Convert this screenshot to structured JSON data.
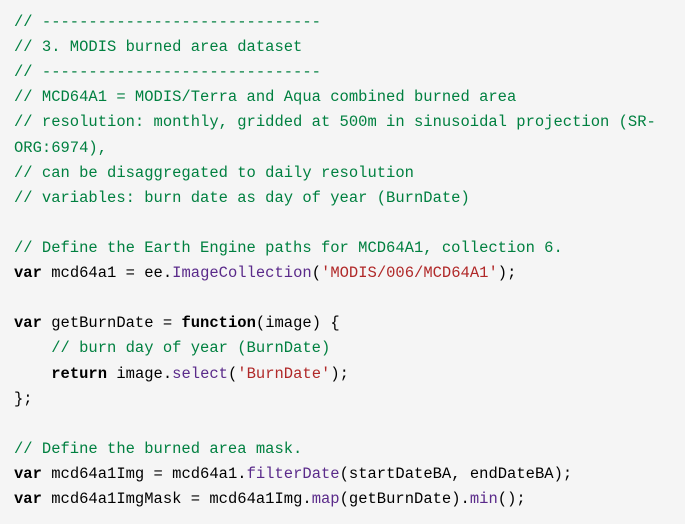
{
  "chart_data": {
    "type": "table",
    "title": "JavaScript code snippet – MODIS burned-area dataset definition",
    "language": "javascript",
    "lines": [
      {
        "text": "// ------------------------------",
        "kind": "comment"
      },
      {
        "text": "// 3. MODIS burned area dataset",
        "kind": "comment"
      },
      {
        "text": "// ------------------------------",
        "kind": "comment"
      },
      {
        "text": "// MCD64A1 = MODIS/Terra and Aqua combined burned area",
        "kind": "comment"
      },
      {
        "text": "// resolution: monthly, gridded at 500m in sinusoidal projection (SR-ORG:6974),",
        "kind": "comment"
      },
      {
        "text": "// can be disaggregated to daily resolution",
        "kind": "comment"
      },
      {
        "text": "// variables: burn date as day of year (BurnDate)",
        "kind": "comment"
      },
      {
        "text": "",
        "kind": "blank"
      },
      {
        "text": "// Define the Earth Engine paths for MCD64A1, collection 6.",
        "kind": "comment"
      },
      {
        "text": "var mcd64a1 = ee.ImageCollection('MODIS/006/MCD64A1');",
        "kind": "code"
      },
      {
        "text": "",
        "kind": "blank"
      },
      {
        "text": "var getBurnDate = function(image) {",
        "kind": "code"
      },
      {
        "text": "    // burn day of year (BurnDate)",
        "kind": "comment-indented"
      },
      {
        "text": "    return image.select('BurnDate');",
        "kind": "code-indented"
      },
      {
        "text": "};",
        "kind": "code"
      },
      {
        "text": "",
        "kind": "blank"
      },
      {
        "text": "// Define the burned area mask.",
        "kind": "comment"
      },
      {
        "text": "var mcd64a1Img = mcd64a1.filterDate(startDateBA, endDateBA);",
        "kind": "code"
      },
      {
        "text": "var mcd64a1ImgMask = mcd64a1Img.map(getBurnDate).min();",
        "kind": "code"
      }
    ]
  },
  "code": {
    "c1": "// ------------------------------",
    "c2": "// 3. MODIS burned area dataset",
    "c3": "// ------------------------------",
    "c4": "// MCD64A1 = MODIS/Terra and Aqua combined burned area",
    "c5": "// resolution: monthly, gridded at 500m in sinusoidal projection (SR-ORG:6974),",
    "c6": "// can be disaggregated to daily resolution",
    "c7": "// variables: burn date as day of year (BurnDate)",
    "c8": "// Define the Earth Engine paths for MCD64A1, collection 6.",
    "kw_var": "var",
    "kw_function": "function",
    "kw_return": "return",
    "id_mcd64a1": "mcd64a1",
    "id_ee": "ee",
    "m_ImageCollection": "ImageCollection",
    "s_modis": "'MODIS/006/MCD64A1'",
    "id_getBurnDate": "getBurnDate",
    "id_image": "image",
    "c9": "// burn day of year (BurnDate)",
    "m_select": "select",
    "s_burndate": "'BurnDate'",
    "c10": "// Define the burned area mask.",
    "id_mcd64a1Img": "mcd64a1Img",
    "m_filterDate": "filterDate",
    "id_startDateBA": "startDateBA",
    "id_endDateBA": "endDateBA",
    "id_mcd64a1ImgMask": "mcd64a1ImgMask",
    "m_map": "map",
    "m_min": "min",
    "p_eq": " = ",
    "p_dot": ".",
    "p_op": "(",
    "p_cp": ")",
    "p_ob": " {",
    "p_cb": "};",
    "p_semi": ";",
    "p_comma": ", ",
    "p_emptyargs": "()",
    "indent": "    ",
    "space": " "
  }
}
